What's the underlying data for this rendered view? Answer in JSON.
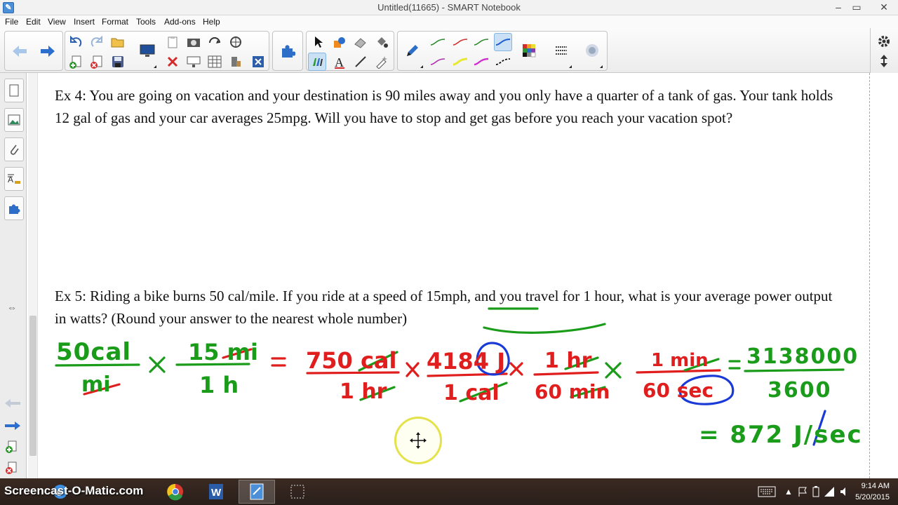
{
  "window": {
    "title": "Untitled(11665) - SMART Notebook",
    "controls": [
      "minimize",
      "restore",
      "close"
    ]
  },
  "menu": [
    "File",
    "Edit",
    "View",
    "Insert",
    "Format",
    "Tools",
    "Add-ons",
    "Help"
  ],
  "toolbar": {
    "nav": [
      "back-arrow-icon",
      "forward-arrow-icon"
    ],
    "file_tools": [
      "undo-icon",
      "redo-icon",
      "open-icon",
      "add-page-icon",
      "delete-page-icon",
      "save-icon",
      "screen-shade-icon",
      "paste-icon",
      "delete-icon",
      "document-camera-icon",
      "show-hide-icon",
      "table-icon",
      "full-screen-icon",
      "capture-icon",
      "close-icon"
    ],
    "addons": "puzzle-icon",
    "pen_tools": [
      "select-icon",
      "shapes-icon",
      "eraser-icon",
      "fill-icon",
      "pen-icon",
      "text-icon",
      "line-icon",
      "magic-pen-icon"
    ],
    "pen_colors": [
      "#2e8b2e",
      "#d03030",
      "#2e8b2e",
      "#1f5fd0",
      "#b030b0",
      "#e8e830",
      "#d030d0",
      "#111111"
    ],
    "settings": "gear-icon"
  },
  "sidebar": [
    "page-sorter-icon",
    "gallery-icon",
    "attachments-icon",
    "properties-icon",
    "addons-icon"
  ],
  "problems": [
    {
      "text": "Ex 4:  You are going on vacation and your destination is 90 miles away and you only have a quarter of a tank of gas.  Your tank holds 12 gal of gas and your car averages 25mpg.  Will you have to stop and get gas before you reach your vacation spot?"
    },
    {
      "text": "Ex 5:  Riding a bike burns 50 cal/mile.  If you ride at a speed of 15mph, and you travel for 1 hour, what is your average power output in watts?  (Round your answer to the nearest whole number)"
    }
  ],
  "handwriting": {
    "colors": {
      "green": "#1a9c1a",
      "red": "#e01e1e",
      "blue": "#1a3ad8"
    },
    "terms": [
      {
        "num": "50cal",
        "den": "mi"
      },
      {
        "num": "15 mi",
        "den": "1 h"
      },
      {
        "num": "750 cal",
        "den": "1 hr"
      },
      {
        "num": "4184 J",
        "den": "1 cal"
      },
      {
        "num": "1 hr",
        "den": "60 min"
      },
      {
        "num": "1 min",
        "den": "60 sec"
      }
    ],
    "result_num": "3138000",
    "result_den": "3600",
    "answer": "= 872 J/sec"
  },
  "taskbar": {
    "watermark": "Screencast-O-Matic.com",
    "time": "9:14 AM",
    "date": "5/20/2015"
  }
}
